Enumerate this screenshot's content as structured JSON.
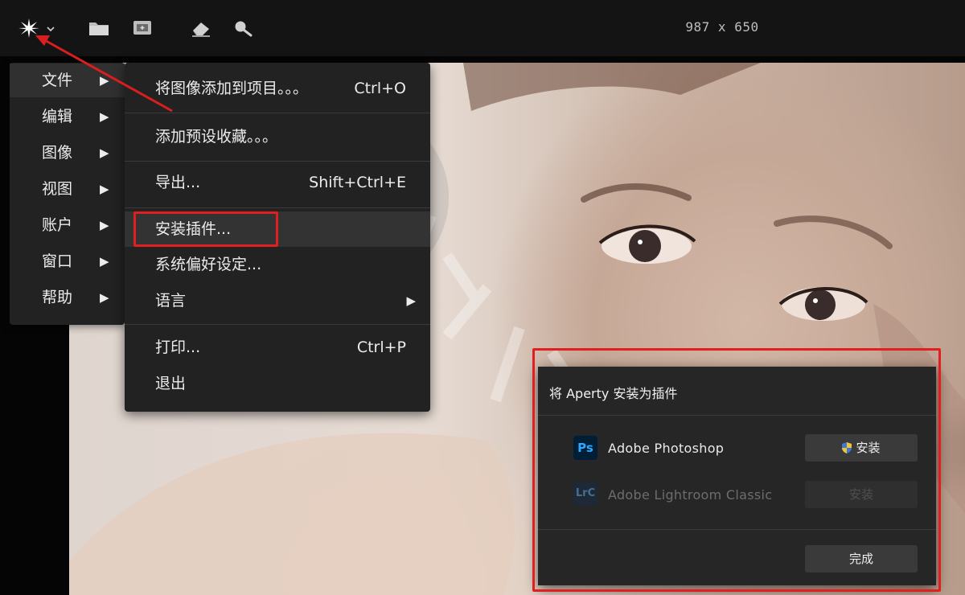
{
  "toolbar": {
    "icons": [
      "app-logo-icon",
      "chevron-down-icon",
      "folder-icon",
      "add-image-icon",
      "eraser-icon",
      "magnifier-icon"
    ],
    "dimensions": "987 x 650"
  },
  "main_menu": {
    "items": [
      {
        "label": "文件",
        "arrow": "▶"
      },
      {
        "label": "编辑",
        "arrow": "▶"
      },
      {
        "label": "图像",
        "arrow": "▶"
      },
      {
        "label": "视图",
        "arrow": "▶"
      },
      {
        "label": "账户",
        "arrow": "▶"
      },
      {
        "label": "窗口",
        "arrow": "▶"
      },
      {
        "label": "帮助",
        "arrow": "▶"
      }
    ]
  },
  "file_menu": {
    "items": [
      {
        "label": "将图像添加到项目。。。",
        "shortcut": "Ctrl+O"
      },
      {
        "label": "添加预设收藏。。。",
        "shortcut": ""
      },
      {
        "label": "导出...",
        "shortcut": "Shift+Ctrl+E"
      },
      {
        "label": "安装插件...",
        "shortcut": ""
      },
      {
        "label": "系统偏好设定...",
        "shortcut": ""
      },
      {
        "label": "语言",
        "arrow": "▶"
      },
      {
        "label": "打印...",
        "shortcut": "Ctrl+P"
      },
      {
        "label": "退出",
        "shortcut": ""
      }
    ]
  },
  "dialog": {
    "title": "将 Aperty 安装为插件",
    "apps": [
      {
        "badge": "Ps",
        "name": "Adobe Photoshop",
        "button": "安装"
      },
      {
        "badge": "LrC",
        "name": "Adobe Lightroom Classic",
        "button": "安装"
      }
    ],
    "done_button": "完成"
  },
  "colors": {
    "highlight_box": "#e02020",
    "menu_bg": "#222222",
    "ps_blue": "#31a8ff"
  }
}
